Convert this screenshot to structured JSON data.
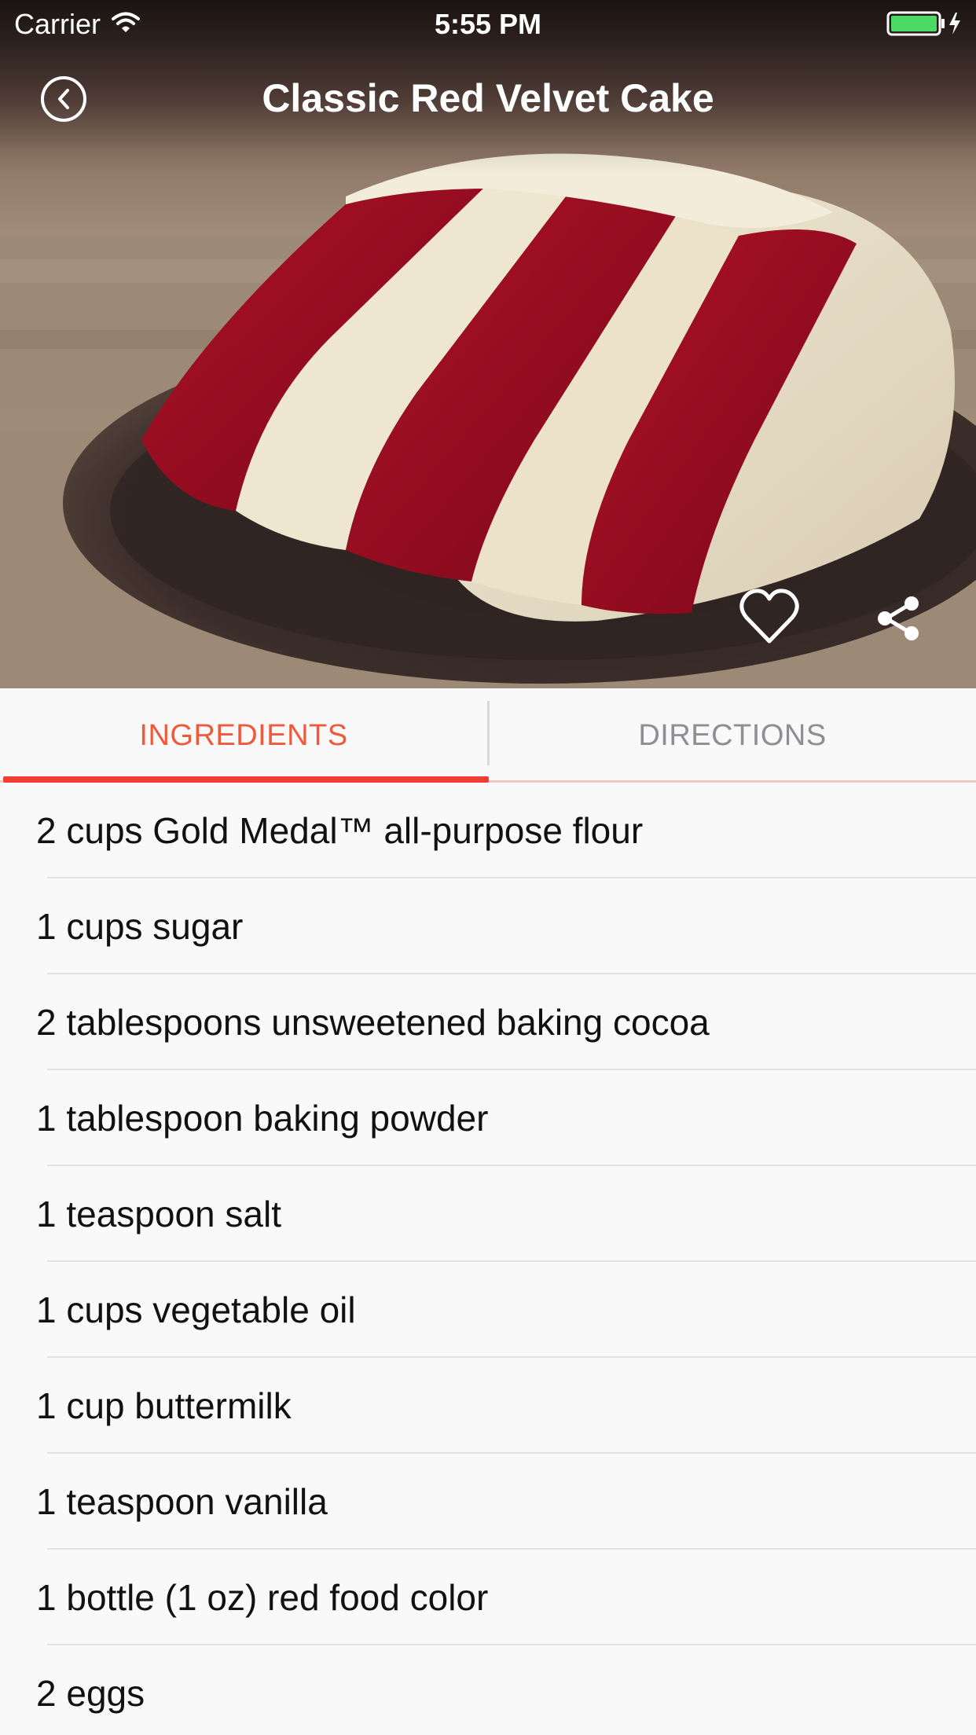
{
  "status_bar": {
    "carrier": "Carrier",
    "time": "5:55 PM"
  },
  "nav": {
    "title": "Classic Red Velvet Cake"
  },
  "icons": {
    "back": "chevron-left-circle-icon",
    "favorite": "heart-outline-icon",
    "share": "share-icon",
    "wifi": "wifi-icon",
    "battery": "battery-charging-icon"
  },
  "tabs": [
    {
      "label": "INGREDIENTS",
      "selected": true
    },
    {
      "label": "DIRECTIONS",
      "selected": false
    }
  ],
  "ingredients": [
    "2 cups Gold Medal™ all-purpose flour",
    "1 cups sugar",
    "2 tablespoons unsweetened baking cocoa",
    "1 tablespoon baking powder",
    "1 teaspoon salt",
    "1 cups vegetable oil",
    "1 cup buttermilk",
    "1 teaspoon vanilla",
    "1 bottle (1 oz) red food color",
    "2 eggs"
  ],
  "colors": {
    "accent": "#f05a3c",
    "tab_underline": "#f03c32",
    "inactive_tab": "#8e8e93",
    "battery_fill": "#4cd964"
  }
}
